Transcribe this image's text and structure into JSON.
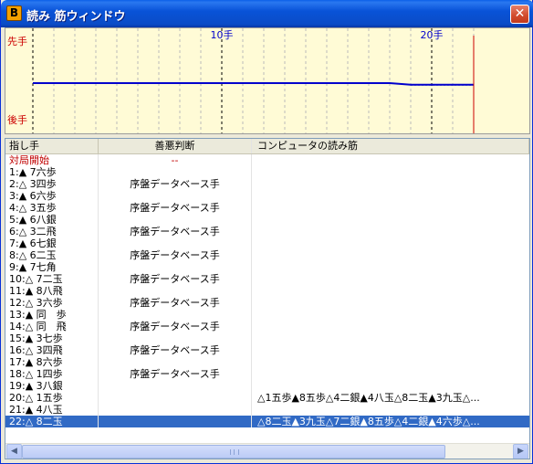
{
  "window": {
    "title": "読み 筋ウィンドウ",
    "icon": "B",
    "close_label": "✕"
  },
  "colors": {
    "titlebar": "#0a4cc7",
    "chart_bg": "#fffbd6",
    "line": "#0000cc",
    "marker": "#cc0000",
    "selection": "#316ac5"
  },
  "chart_data": {
    "type": "line",
    "x_range": [
      1,
      22
    ],
    "y_labels": {
      "top": "先手",
      "bottom": "後手"
    },
    "x_labels": [
      {
        "move": 10,
        "label": "10手"
      },
      {
        "move": 20,
        "label": "20手"
      }
    ],
    "series": [
      {
        "values": [
          0,
          0,
          0,
          0,
          0,
          0,
          0,
          0,
          0,
          0,
          0,
          0,
          0,
          0,
          0,
          0,
          0,
          0,
          -0.3,
          -0.3,
          -0.3,
          -0.3
        ]
      },
      {
        "style": "dashed",
        "x": [
          19,
          20,
          21,
          22
        ],
        "values": [
          -0.35,
          -0.35,
          -0.35,
          -0.35
        ]
      }
    ],
    "current_move": 22
  },
  "columns": [
    "指し手",
    "善悪判断",
    "コンピュータの読み筋"
  ],
  "rows": [
    {
      "move": "対局開始",
      "eval": "--",
      "pv": "",
      "style": "red"
    },
    {
      "move": "1:▲ 7六歩",
      "eval": "",
      "pv": ""
    },
    {
      "move": "2:△ 3四歩",
      "eval": "序盤データベース手",
      "pv": ""
    },
    {
      "move": "3:▲ 6六歩",
      "eval": "",
      "pv": ""
    },
    {
      "move": "4:△ 3五歩",
      "eval": "序盤データベース手",
      "pv": ""
    },
    {
      "move": "5:▲ 6八銀",
      "eval": "",
      "pv": ""
    },
    {
      "move": "6:△ 3二飛",
      "eval": "序盤データベース手",
      "pv": ""
    },
    {
      "move": "7:▲ 6七銀",
      "eval": "",
      "pv": ""
    },
    {
      "move": "8:△ 6二玉",
      "eval": "序盤データベース手",
      "pv": ""
    },
    {
      "move": "9:▲ 7七角",
      "eval": "",
      "pv": ""
    },
    {
      "move": "10:△ 7二玉",
      "eval": "序盤データベース手",
      "pv": ""
    },
    {
      "move": "11:▲ 8八飛",
      "eval": "",
      "pv": ""
    },
    {
      "move": "12:△ 3六歩",
      "eval": "序盤データベース手",
      "pv": ""
    },
    {
      "move": "13:▲ 同　歩",
      "eval": "",
      "pv": ""
    },
    {
      "move": "14:△ 同　飛",
      "eval": "序盤データベース手",
      "pv": ""
    },
    {
      "move": "15:▲ 3七歩",
      "eval": "",
      "pv": ""
    },
    {
      "move": "16:△ 3四飛",
      "eval": "序盤データベース手",
      "pv": ""
    },
    {
      "move": "17:▲ 8六歩",
      "eval": "",
      "pv": ""
    },
    {
      "move": "18:△ 1四歩",
      "eval": "序盤データベース手",
      "pv": ""
    },
    {
      "move": "19:▲ 3八銀",
      "eval": "",
      "pv": ""
    },
    {
      "move": "20:△ 1五歩",
      "eval": "",
      "pv": "△1五歩▲8五歩△4二銀▲4八玉△8二玉▲3九玉△..."
    },
    {
      "move": "21:▲ 4八玉",
      "eval": "",
      "pv": ""
    },
    {
      "move": "22:△ 8二玉",
      "eval": "",
      "pv": "△8二玉▲3九玉△7二銀▲8五歩△4二銀▲4六歩△...",
      "style": "sel"
    }
  ],
  "scroll": {
    "left_arrow": "◀",
    "right_arrow": "▶"
  }
}
